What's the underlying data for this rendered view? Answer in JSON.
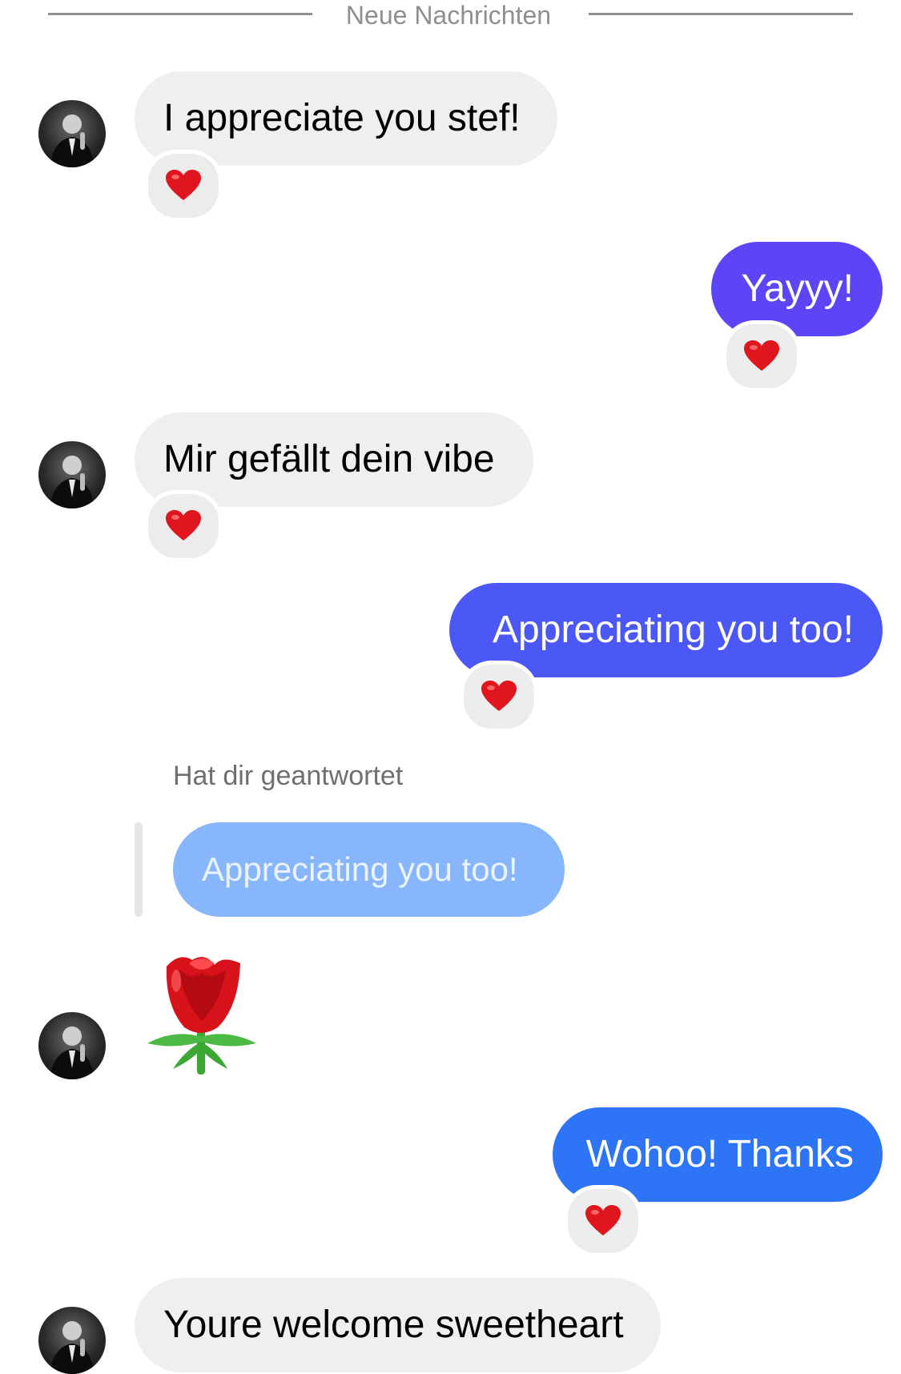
{
  "divider": {
    "label": "Neue Nachrichten"
  },
  "messages": [
    {
      "text": "I appreciate you stef!",
      "direction": "in",
      "reaction": "heart"
    },
    {
      "text": "Yayyy!",
      "direction": "out",
      "reaction": "heart",
      "color": "#5b45f7"
    },
    {
      "text": "Mir gefällt dein vibe",
      "direction": "in",
      "reaction": "heart"
    },
    {
      "text": "Appreciating you too!",
      "direction": "out",
      "reaction": "heart",
      "color": "#4b58f5"
    },
    {
      "text": "Hat dir geantwortet",
      "quoted": "Appreciating you too!",
      "direction": "in",
      "content": "rose-emoji"
    },
    {
      "text": "Wohoo! Thanks",
      "direction": "out",
      "reaction": "heart",
      "color": "#2d74f6"
    },
    {
      "text": "Youre welcome sweetheart",
      "direction": "in"
    }
  ],
  "colors": {
    "incoming_bubble": "#efefef",
    "quoted_bubble": "#88b6fc",
    "reaction_bg": "#ececec",
    "heart": "#e0161e"
  }
}
